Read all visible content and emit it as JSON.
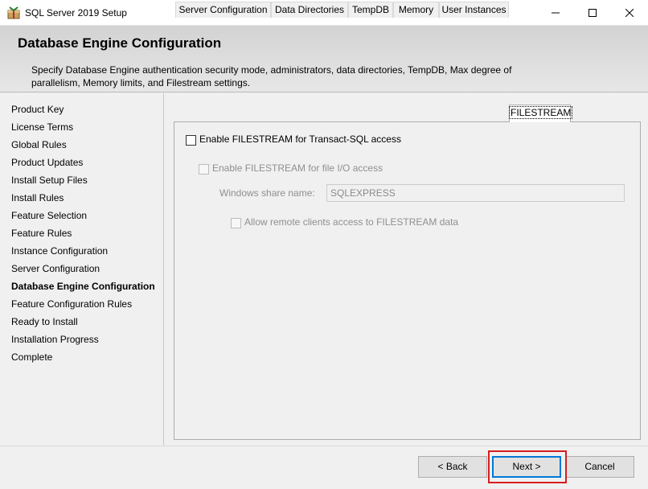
{
  "window": {
    "title": "SQL Server 2019 Setup",
    "controls": [
      "minimize-icon",
      "maximize-icon",
      "close-icon"
    ]
  },
  "header": {
    "title": "Database Engine Configuration",
    "description_line1": "Specify Database Engine authentication security mode, administrators, data directories, TempDB, Max degree of",
    "description_line2": "parallelism, Memory limits, and Filestream settings."
  },
  "nav": {
    "items": [
      {
        "label": "Product Key"
      },
      {
        "label": "License Terms"
      },
      {
        "label": "Global Rules"
      },
      {
        "label": "Product Updates"
      },
      {
        "label": "Install Setup Files"
      },
      {
        "label": "Install Rules"
      },
      {
        "label": "Feature Selection"
      },
      {
        "label": "Feature Rules"
      },
      {
        "label": "Instance Configuration"
      },
      {
        "label": "Server Configuration"
      },
      {
        "label": "Database Engine Configuration",
        "active": true
      },
      {
        "label": "Feature Configuration Rules"
      },
      {
        "label": "Ready to Install"
      },
      {
        "label": "Installation Progress"
      },
      {
        "label": "Complete"
      }
    ]
  },
  "tabs": [
    {
      "label": "Server Configuration"
    },
    {
      "label": "Data Directories"
    },
    {
      "label": "TempDB"
    },
    {
      "label": "Memory"
    },
    {
      "label": "User Instances"
    },
    {
      "label": "FILESTREAM",
      "selected": true
    }
  ],
  "filestream": {
    "enable_tsql": {
      "label": "Enable FILESTREAM for Transact-SQL access",
      "checked": false
    },
    "enable_file_io": {
      "label": "Enable FILESTREAM for file I/O access",
      "checked": false,
      "disabled": true
    },
    "share_name": {
      "label": "Windows share name:",
      "value": "SQLEXPRESS",
      "disabled": true
    },
    "allow_remote": {
      "label": "Allow remote clients access to FILESTREAM data",
      "checked": false,
      "disabled": true
    }
  },
  "buttons": {
    "back": "< Back",
    "next": "Next >",
    "cancel": "Cancel"
  }
}
